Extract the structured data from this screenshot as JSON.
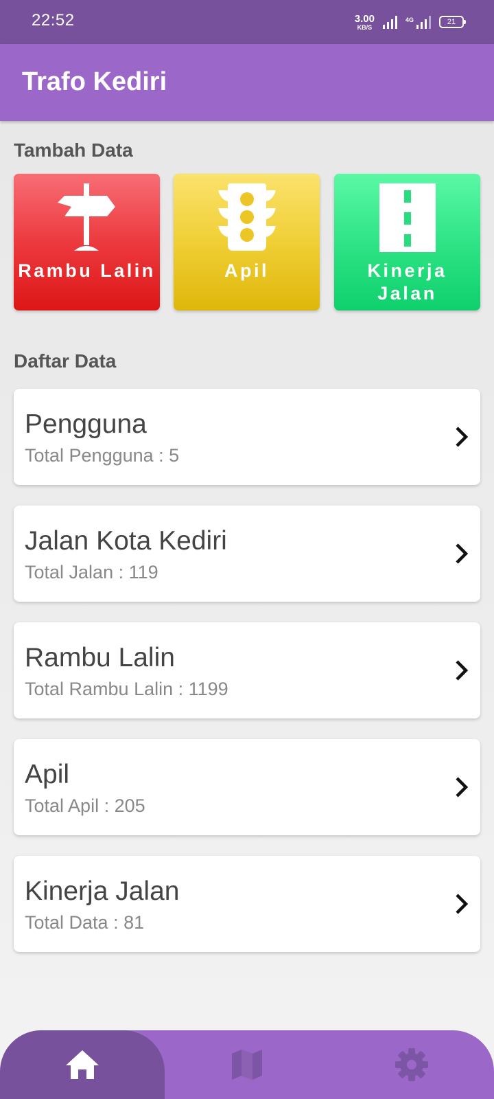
{
  "status": {
    "time": "22:52",
    "net_speed_value": "3.00",
    "net_speed_unit": "KB/S",
    "network_type": "4G",
    "battery": "21"
  },
  "app": {
    "title": "Trafo Kediri"
  },
  "add_section": {
    "title": "Tambah Data",
    "tiles": [
      {
        "label": "Rambu Lalin",
        "icon": "signpost-icon",
        "color": "#e8282d"
      },
      {
        "label": "Apil",
        "icon": "traffic-light-icon",
        "color": "#ecc526"
      },
      {
        "label_line1": "Kinerja",
        "label_line2": "Jalan",
        "icon": "road-icon",
        "color": "#27dd7d"
      }
    ]
  },
  "list_section": {
    "title": "Daftar Data",
    "items": [
      {
        "title": "Pengguna",
        "subtitle": "Total Pengguna : 5"
      },
      {
        "title": "Jalan Kota Kediri",
        "subtitle": "Total Jalan : 119"
      },
      {
        "title": "Rambu Lalin",
        "subtitle": "Total Rambu Lalin : 1199"
      },
      {
        "title": "Apil",
        "subtitle": "Total Apil : 205"
      },
      {
        "title": "Kinerja Jalan",
        "subtitle": "Total Data : 81"
      }
    ]
  },
  "bottom_nav": {
    "items": [
      {
        "icon": "home-icon",
        "active": true
      },
      {
        "icon": "map-icon",
        "active": false
      },
      {
        "icon": "gear-icon",
        "active": false
      }
    ]
  },
  "colors": {
    "primary": "#9b67c8",
    "primary_dark": "#77519c"
  }
}
